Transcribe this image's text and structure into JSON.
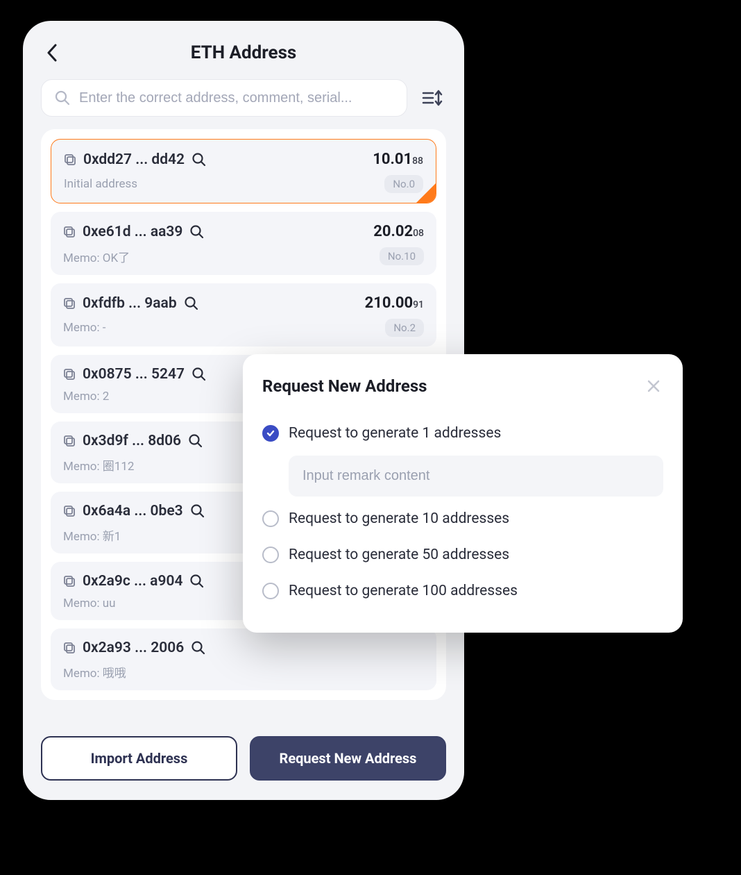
{
  "header": {
    "title": "ETH Address"
  },
  "search": {
    "placeholder": "Enter the correct address, comment, serial..."
  },
  "addresses": [
    {
      "addr": "0xdd27 ... dd42",
      "balance": "10.01",
      "balance_small": "88",
      "memo": "Initial address",
      "no": "No.0",
      "selected": true
    },
    {
      "addr": "0xe61d ... aa39",
      "balance": "20.02",
      "balance_small": "08",
      "memo": "Memo: OK了",
      "no": "No.10",
      "selected": false
    },
    {
      "addr": "0xfdfb ... 9aab",
      "balance": "210.00",
      "balance_small": "91",
      "memo": "Memo: -",
      "no": "No.2",
      "selected": false
    },
    {
      "addr": "0x0875 ... 5247",
      "balance": "",
      "balance_small": "",
      "memo": "Memo: 2",
      "no": "",
      "selected": false
    },
    {
      "addr": "0x3d9f ... 8d06",
      "balance": "",
      "balance_small": "",
      "memo": "Memo: 圈112",
      "no": "",
      "selected": false
    },
    {
      "addr": "0x6a4a ... 0be3",
      "balance": "",
      "balance_small": "",
      "memo": "Memo: 新1",
      "no": "",
      "selected": false
    },
    {
      "addr": "0x2a9c ... a904",
      "balance": "",
      "balance_small": "",
      "memo": "Memo: uu",
      "no": "",
      "selected": false
    },
    {
      "addr": "0x2a93 ... 2006",
      "balance": "",
      "balance_small": "",
      "memo": "Memo: 哦哦",
      "no": "",
      "selected": false
    }
  ],
  "footer": {
    "import_label": "Import Address",
    "request_label": "Request New Address"
  },
  "modal": {
    "title": "Request New Address",
    "remark_placeholder": "Input remark content",
    "options": [
      {
        "label": "Request to generate 1 addresses",
        "checked": true
      },
      {
        "label": "Request to generate 10 addresses",
        "checked": false
      },
      {
        "label": "Request to generate 50 addresses",
        "checked": false
      },
      {
        "label": "Request to generate 100 addresses",
        "checked": false
      }
    ]
  }
}
